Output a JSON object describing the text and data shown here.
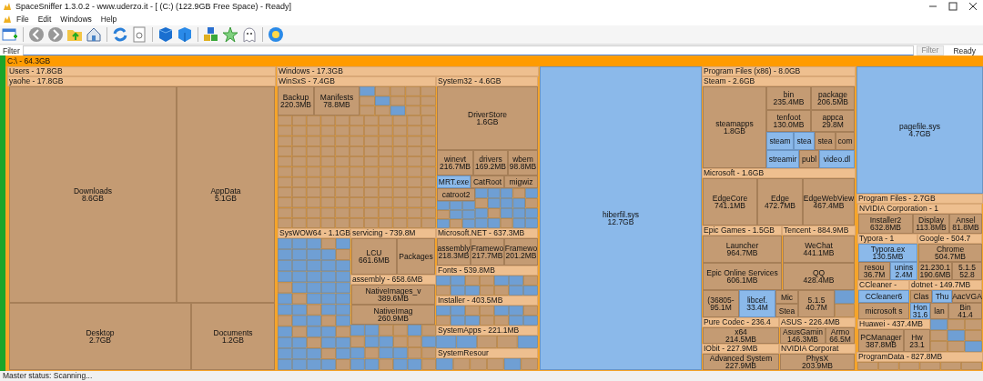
{
  "window": {
    "title": "SpaceSniffer 1.3.0.2 - www.uderzo.it - [ (C:) (122.9GB Free Space) - Ready]"
  },
  "menu": [
    {
      "label": "File"
    },
    {
      "label": "Edit"
    },
    {
      "label": "Windows"
    },
    {
      "label": "Help"
    }
  ],
  "filter": {
    "label": "Filter",
    "button": "Filter",
    "button_disabled": true,
    "status": "Ready"
  },
  "treemap": {
    "root": "C:\\ - 64.3GB",
    "nodes": [
      {
        "kind": "group",
        "label": "Users - 17.8GB",
        "children": [
          {
            "kind": "group",
            "label": "yaohe - 17.8GB",
            "children": [
              {
                "kind": "folder",
                "name": "Downloads",
                "size": "8.6GB"
              },
              {
                "kind": "folder",
                "name": "AppData",
                "size": "5.1GB"
              },
              {
                "kind": "folder",
                "name": "Desktop",
                "size": "2.7GB"
              },
              {
                "kind": "folder",
                "name": "Documents",
                "size": "1.2GB"
              }
            ]
          }
        ]
      },
      {
        "kind": "group",
        "label": "Windows - 17.3GB",
        "children": [
          {
            "kind": "group",
            "label": "WinSxS - 7.4GB",
            "children": [
              {
                "kind": "folder",
                "name": "Backup",
                "size": "220.3MB"
              },
              {
                "kind": "folder",
                "name": "Manifests",
                "size": "78.8MB"
              }
            ]
          },
          {
            "kind": "group",
            "label": "System32 - 4.6GB",
            "children": [
              {
                "kind": "folder",
                "name": "DriverStore",
                "size": "1.6GB"
              },
              {
                "kind": "folder",
                "name": "winevt",
                "size": "216.7MB"
              },
              {
                "kind": "folder",
                "name": "drivers",
                "size": "169.2MB"
              },
              {
                "kind": "folder",
                "name": "wbem",
                "size": "98.8MB"
              },
              {
                "kind": "file",
                "name": "MRT.exe"
              },
              {
                "kind": "folder",
                "name": "CatRoot"
              },
              {
                "kind": "folder",
                "name": "migwiz"
              },
              {
                "kind": "folder",
                "name": "catroot2"
              }
            ]
          },
          {
            "kind": "group",
            "label": "SysWOW64 - 1.1GB"
          },
          {
            "kind": "group",
            "label": "servicing - 739.8M",
            "children": [
              {
                "kind": "folder",
                "name": "LCU",
                "size": "661.6MB"
              },
              {
                "kind": "folder",
                "name": "Packages"
              }
            ]
          },
          {
            "kind": "group",
            "label": "Microsoft.NET - 637.3MB",
            "children": [
              {
                "kind": "folder",
                "name": "assembly",
                "size": "218.3MB"
              },
              {
                "kind": "folder",
                "name": "Framewo",
                "size": "217.7MB"
              },
              {
                "kind": "folder",
                "name": "Framewo",
                "size": "201.2MB"
              }
            ]
          },
          {
            "kind": "group",
            "label": "Fonts - 539.8MB"
          },
          {
            "kind": "group",
            "label": "assembly - 658.6MB",
            "children": [
              {
                "kind": "folder",
                "name": "NativeImages_v",
                "size": "389.6MB"
              },
              {
                "kind": "folder",
                "name": "NativeImag",
                "size": "260.9MB"
              }
            ]
          },
          {
            "kind": "group",
            "label": "Installer - 403.5MB"
          },
          {
            "kind": "group",
            "label": "SystemApps - 221.1MB"
          },
          {
            "kind": "group",
            "label": "SystemResour"
          }
        ]
      },
      {
        "kind": "file",
        "name": "hiberfil.sys",
        "size": "12.7GB"
      },
      {
        "kind": "group",
        "label": "Program Files (x86) - 8.0GB",
        "children": [
          {
            "kind": "group",
            "label": "Steam - 2.6GB",
            "children": [
              {
                "kind": "folder",
                "name": "steamapps",
                "size": "1.8GB"
              },
              {
                "kind": "folder",
                "name": "bin",
                "size": "235.4MB"
              },
              {
                "kind": "folder",
                "name": "package",
                "size": "206.5MB"
              },
              {
                "kind": "folder",
                "name": "tenfoot",
                "size": "130.0MB"
              },
              {
                "kind": "folder",
                "name": "appca",
                "size": "29.8M"
              },
              {
                "kind": "file",
                "name": "steam"
              },
              {
                "kind": "file",
                "name": "stea"
              },
              {
                "kind": "folder",
                "name": "stea"
              },
              {
                "kind": "folder",
                "name": "com"
              },
              {
                "kind": "file",
                "name": "streamir"
              },
              {
                "kind": "folder",
                "name": "publ"
              },
              {
                "kind": "file",
                "name": "video.dl"
              }
            ]
          },
          {
            "kind": "group",
            "label": "Microsoft - 1.6GB",
            "children": [
              {
                "kind": "folder",
                "name": "EdgeCore",
                "size": "741.1MB"
              },
              {
                "kind": "folder",
                "name": "Edge",
                "size": "472.7MB"
              },
              {
                "kind": "folder",
                "name": "EdgeWebView",
                "size": "467.4MB"
              }
            ]
          },
          {
            "kind": "group",
            "label": "Epic Games - 1.5GB",
            "children": [
              {
                "kind": "folder",
                "name": "Launcher",
                "size": "964.7MB"
              },
              {
                "kind": "folder",
                "name": "Epic Online Services",
                "size": "606.1MB"
              }
            ]
          },
          {
            "kind": "group",
            "label": "Tencent - 884.9MB",
            "children": [
              {
                "kind": "folder",
                "name": "WeChat",
                "size": "441.1MB"
              },
              {
                "kind": "folder",
                "name": "QQ",
                "size": "428.4MB"
              }
            ]
          },
          {
            "kind": "folder",
            "name": "(36805-",
            "size": "95.1M"
          },
          {
            "kind": "file",
            "name": "libcef.",
            "size": "33.4M"
          },
          {
            "kind": "folder",
            "name": "Mic"
          },
          {
            "kind": "folder",
            "name": "Stea"
          },
          {
            "kind": "folder",
            "name": "5.1.5",
            "size": "40.7M"
          },
          {
            "kind": "group",
            "label": "Pure Codec - 236.4",
            "children": [
              {
                "kind": "folder",
                "name": "x64",
                "size": "214.5MB"
              }
            ]
          },
          {
            "kind": "group",
            "label": "ASUS - 226.4MB",
            "children": [
              {
                "kind": "folder",
                "name": "AsusGamin",
                "size": "146.3MB"
              },
              {
                "kind": "folder",
                "name": "Armo",
                "size": "66.5M"
              }
            ]
          },
          {
            "kind": "group",
            "label": "IObit - 227.9MB",
            "children": [
              {
                "kind": "folder",
                "name": "Advanced System",
                "size": "227.9MB"
              }
            ]
          },
          {
            "kind": "group",
            "label": "NVIDIA Corporat",
            "children": [
              {
                "kind": "folder",
                "name": "PhysX",
                "size": "203.9MB"
              }
            ]
          }
        ]
      },
      {
        "kind": "file",
        "name": "pagefile.sys",
        "size": "4.7GB"
      },
      {
        "kind": "group",
        "label": "Program Files - 2.7GB",
        "children": [
          {
            "kind": "group",
            "label": "NVIDIA Corporation - 1",
            "children": [
              {
                "kind": "folder",
                "name": "Installer2",
                "size": "632.8MB"
              },
              {
                "kind": "folder",
                "name": "Display",
                "size": "113.8MB"
              },
              {
                "kind": "folder",
                "name": "Ansel",
                "size": "81.8MB"
              }
            ]
          },
          {
            "kind": "group",
            "label": "Typora - 1",
            "children": [
              {
                "kind": "file",
                "name": "Typora.ex",
                "size": "130.5MB"
              },
              {
                "kind": "folder",
                "name": "resou",
                "size": "36.7M"
              },
              {
                "kind": "file",
                "name": "unins",
                "size": "2.4M"
              }
            ]
          },
          {
            "kind": "group",
            "label": "Google - 504.7",
            "children": [
              {
                "kind": "folder",
                "name": "Chrome",
                "size": "504.7MB"
              }
            ]
          },
          {
            "kind": "folder",
            "name": "21.230.1",
            "size": "190.6MB"
          },
          {
            "kind": "folder",
            "name": "5.1.5",
            "size": "52.8"
          },
          {
            "kind": "group",
            "label": "CCleaner -",
            "children": [
              {
                "kind": "file",
                "name": "CCleaner6"
              },
              {
                "kind": "folder",
                "name": "microsoft s"
              }
            ]
          },
          {
            "kind": "group",
            "label": "dotnet - 149.7MB"
          },
          {
            "kind": "folder",
            "name": "Clas"
          },
          {
            "kind": "file",
            "name": "Thu"
          },
          {
            "kind": "folder",
            "name": "AacVGA"
          },
          {
            "kind": "file",
            "name": "Hon",
            "size": "31.6"
          },
          {
            "kind": "folder",
            "name": "lan"
          },
          {
            "kind": "folder",
            "name": "Bin",
            "size": "41.4"
          },
          {
            "kind": "group",
            "label": "Huawei - 437.4MB",
            "children": [
              {
                "kind": "folder",
                "name": "PCManager",
                "size": "387.8MB"
              },
              {
                "kind": "folder",
                "name": "Hw",
                "size": "23.1"
              }
            ]
          }
        ]
      },
      {
        "kind": "group",
        "label": "ProgramData - 827.8MB"
      }
    ]
  },
  "status_bar": "Master status: Scanning..."
}
